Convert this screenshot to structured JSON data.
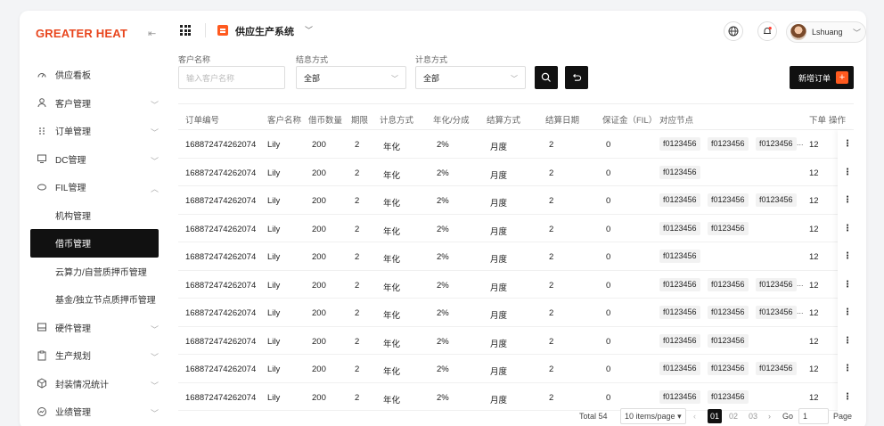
{
  "brand": {
    "logo_text": "GREATER HEAT",
    "accent": "#ff5a1f"
  },
  "sidebar": {
    "items": [
      {
        "label": "供应看板",
        "icon": "gauge-icon",
        "expandable": false
      },
      {
        "label": "客户管理",
        "icon": "user-icon",
        "expandable": true
      },
      {
        "label": "订单管理",
        "icon": "dots-grid-icon",
        "expandable": true
      },
      {
        "label": "DC管理",
        "icon": "monitor-icon",
        "expandable": true
      },
      {
        "label": "FIL管理",
        "icon": "coin-icon",
        "expandable": true,
        "expanded": true
      },
      {
        "label": "机构管理",
        "sub": true
      },
      {
        "label": "借币管理",
        "sub": true,
        "active": true
      },
      {
        "label": "云算力/自营质押币管理",
        "sub": true
      },
      {
        "label": "基金/独立节点质押币管理",
        "sub": true
      },
      {
        "label": "硬件管理",
        "icon": "hardware-icon",
        "expandable": true
      },
      {
        "label": "生产规划",
        "icon": "clipboard-icon",
        "expandable": true
      },
      {
        "label": "封装情况统计",
        "icon": "package-icon",
        "expandable": true
      },
      {
        "label": "业绩管理",
        "icon": "performance-icon",
        "expandable": true
      }
    ]
  },
  "header": {
    "system_title": "供应生产系统",
    "user_name": "Lshuang"
  },
  "filters": {
    "customer_label": "客户名称",
    "customer_placeholder": "输入客户名称",
    "settle_label": "结息方式",
    "settle_value": "全部",
    "interest_label": "计息方式",
    "interest_value": "全部",
    "new_order_label": "新增订单"
  },
  "table": {
    "headers": [
      "订单编号",
      "客户名称",
      "借币数量",
      "期限",
      "计息方式",
      "年化/分成",
      "结算方式",
      "结算日期",
      "保证金（FIL）",
      "对应节点",
      "下单",
      "操作"
    ],
    "rows": [
      {
        "id": "168872474262074",
        "customer": "Lily",
        "amount": "200",
        "term": "2",
        "interest": "年化",
        "rate": "2%",
        "settle": "月度",
        "date": "2",
        "deposit": "0",
        "nodes": [
          "f0123456",
          "f0123456",
          "f0123456"
        ],
        "more": true,
        "order": "12"
      },
      {
        "id": "168872474262074",
        "customer": "Lily",
        "amount": "200",
        "term": "2",
        "interest": "年化",
        "rate": "2%",
        "settle": "月度",
        "date": "2",
        "deposit": "0",
        "nodes": [
          "f0123456"
        ],
        "more": false,
        "order": "12"
      },
      {
        "id": "168872474262074",
        "customer": "Lily",
        "amount": "200",
        "term": "2",
        "interest": "年化",
        "rate": "2%",
        "settle": "月度",
        "date": "2",
        "deposit": "0",
        "nodes": [
          "f0123456",
          "f0123456",
          "f0123456"
        ],
        "more": false,
        "order": "12"
      },
      {
        "id": "168872474262074",
        "customer": "Lily",
        "amount": "200",
        "term": "2",
        "interest": "年化",
        "rate": "2%",
        "settle": "月度",
        "date": "2",
        "deposit": "0",
        "nodes": [
          "f0123456",
          "f0123456"
        ],
        "more": false,
        "order": "12"
      },
      {
        "id": "168872474262074",
        "customer": "Lily",
        "amount": "200",
        "term": "2",
        "interest": "年化",
        "rate": "2%",
        "settle": "月度",
        "date": "2",
        "deposit": "0",
        "nodes": [
          "f0123456"
        ],
        "more": false,
        "order": "12"
      },
      {
        "id": "168872474262074",
        "customer": "Lily",
        "amount": "200",
        "term": "2",
        "interest": "年化",
        "rate": "2%",
        "settle": "月度",
        "date": "2",
        "deposit": "0",
        "nodes": [
          "f0123456",
          "f0123456",
          "f0123456"
        ],
        "more": true,
        "order": "12"
      },
      {
        "id": "168872474262074",
        "customer": "Lily",
        "amount": "200",
        "term": "2",
        "interest": "年化",
        "rate": "2%",
        "settle": "月度",
        "date": "2",
        "deposit": "0",
        "nodes": [
          "f0123456",
          "f0123456",
          "f0123456"
        ],
        "more": true,
        "order": "12"
      },
      {
        "id": "168872474262074",
        "customer": "Lily",
        "amount": "200",
        "term": "2",
        "interest": "年化",
        "rate": "2%",
        "settle": "月度",
        "date": "2",
        "deposit": "0",
        "nodes": [
          "f0123456",
          "f0123456"
        ],
        "more": false,
        "order": "12"
      },
      {
        "id": "168872474262074",
        "customer": "Lily",
        "amount": "200",
        "term": "2",
        "interest": "年化",
        "rate": "2%",
        "settle": "月度",
        "date": "2",
        "deposit": "0",
        "nodes": [
          "f0123456",
          "f0123456",
          "f0123456"
        ],
        "more": false,
        "order": "12"
      },
      {
        "id": "168872474262074",
        "customer": "Lily",
        "amount": "200",
        "term": "2",
        "interest": "年化",
        "rate": "2%",
        "settle": "月度",
        "date": "2",
        "deposit": "0",
        "nodes": [
          "f0123456",
          "f0123456"
        ],
        "more": false,
        "order": "12"
      }
    ],
    "more_text": "...",
    "ops_glyph": "⋮"
  },
  "pager": {
    "total": "Total 54",
    "page_size": "10 items/page",
    "pages": [
      "01",
      "02",
      "03"
    ],
    "goto_label": "Go",
    "goto_value": "1",
    "page_label": "Page"
  }
}
